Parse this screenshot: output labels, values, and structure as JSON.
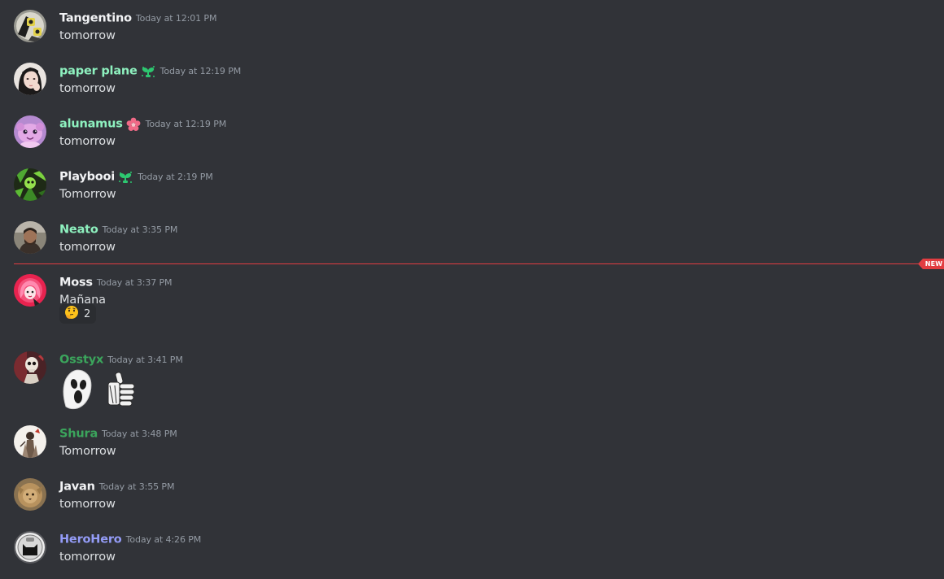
{
  "colors": {
    "background": "#313338",
    "timestamp": "#949ba4",
    "message_text": "#dbdee1",
    "new_divider": "#e23d41"
  },
  "new_divider_label": "NEW",
  "messages": [
    {
      "username": "Tangentino",
      "name_color": "#f2f3f5",
      "badge": null,
      "timestamp": "Today at 12:01 PM",
      "text": "tomorrow",
      "avatar": "gray-robot-avatar"
    },
    {
      "username": "paper plane",
      "name_color": "#8ef1bf",
      "badge": "sprout-icon",
      "timestamp": "Today at 12:19 PM",
      "text": "tomorrow",
      "avatar": "girl-photo-avatar"
    },
    {
      "username": "alunamus",
      "name_color": "#8ef1bf",
      "badge": "pink-flower-icon",
      "timestamp": "Today at 12:19 PM",
      "text": "tomorrow",
      "avatar": "pink-creature-avatar"
    },
    {
      "username": "Playbooi",
      "name_color": "#f2f3f5",
      "badge": "sprout-icon",
      "timestamp": "Today at 2:19 PM",
      "text": "Tomorrow",
      "avatar": "green-pattern-avatar"
    },
    {
      "username": "Neato",
      "name_color": "#8ef1bf",
      "badge": null,
      "timestamp": "Today at 3:35 PM",
      "text": "tomorrow",
      "avatar": "man-photo-avatar"
    },
    {
      "username": "Moss",
      "name_color": "#f2f3f5",
      "badge": null,
      "timestamp": "Today at 3:37 PM",
      "text": "Mañana",
      "avatar": "pink-hair-avatar",
      "reaction": {
        "emoji": "thinking-face-icon",
        "count": "2"
      }
    },
    {
      "username": "Osstyx",
      "name_color": "#3ba55c",
      "badge": null,
      "timestamp": "Today at 3:41 PM",
      "text": "",
      "avatar": "skeleton-avatar",
      "stickers": [
        "ghost-sticker-icon",
        "skeleton-thumbs-up-sticker-icon"
      ]
    },
    {
      "username": "Shura",
      "name_color": "#3ba55c",
      "badge": null,
      "timestamp": "Today at 3:48 PM",
      "text": "Tomorrow",
      "avatar": "sketch-figure-avatar"
    },
    {
      "username": "Javan",
      "name_color": "#f2f3f5",
      "badge": null,
      "timestamp": "Today at 3:55 PM",
      "text": "tomorrow",
      "avatar": "lion-avatar"
    },
    {
      "username": "HeroHero",
      "name_color": "#949cf7",
      "badge": null,
      "timestamp": "Today at 4:26 PM",
      "text": "tomorrow",
      "avatar": "gray-cat-avatar"
    }
  ]
}
